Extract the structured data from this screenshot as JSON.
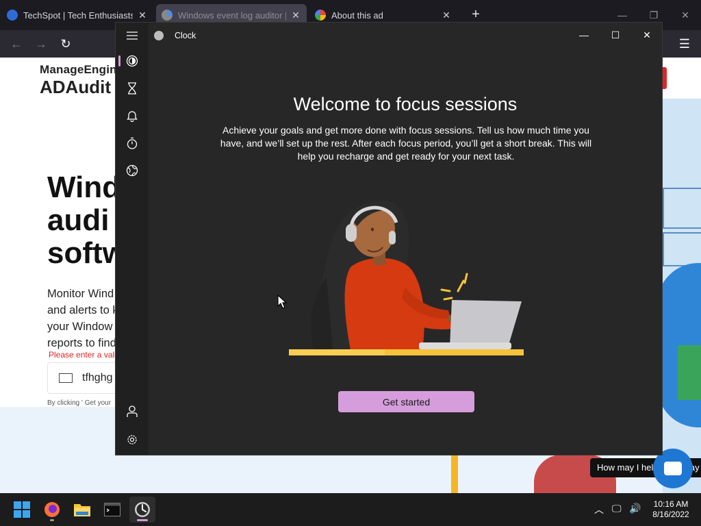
{
  "browser": {
    "tabs": [
      {
        "title": "TechSpot | Tech Enthusiasts, Po",
        "favicon": "techspot-favicon",
        "active": false
      },
      {
        "title": "Windows event log auditor | M",
        "favicon": "loading-favicon",
        "active": true
      },
      {
        "title": "About this ad",
        "favicon": "google-favicon",
        "active": false
      }
    ]
  },
  "webpage": {
    "logo_line1": "ManageEngin",
    "logo_line2": "ADAudit",
    "heading_lines": [
      "Wind",
      "audi",
      "softw"
    ],
    "paragraph_lines": [
      "Monitor Wind",
      "and alerts to k",
      "your Window",
      "reports to find"
    ],
    "error_text": "Please enter a vali",
    "email_value": "tfhghg",
    "consent_text": "By clicking ' Get your",
    "chat_prompt": "How may I help you today"
  },
  "clock_app": {
    "window_title": "Clock",
    "heading": "Welcome to focus sessions",
    "description": "Achieve your goals and get more done with focus sessions. Tell us how much time you have, and we’ll set up the rest. After each focus period, you’ll get a short break. This will help you recharge and get ready for your next task.",
    "primary_button": "Get started",
    "accent_color": "#d69ddc",
    "nav_items": [
      "focus-sessions-icon",
      "timer-icon",
      "alarm-icon",
      "stopwatch-icon",
      "world-clock-icon"
    ]
  },
  "taskbar": {
    "time": "10:16 AM",
    "date": "8/16/2022"
  }
}
